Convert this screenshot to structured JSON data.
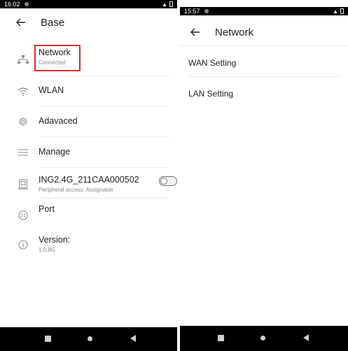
{
  "left": {
    "status": {
      "time": "16:02"
    },
    "header": {
      "title": "Base"
    },
    "items": [
      {
        "label": "Network",
        "sub": "Connected",
        "icon": "network-icon"
      },
      {
        "label": "WLAN",
        "icon": "wifi-icon"
      },
      {
        "label": "Adavaced",
        "icon": "gear-icon"
      },
      {
        "label": "Manage",
        "icon": "menu-icon"
      },
      {
        "label": "ING2.4G_211CAA000502",
        "sub": "Peripheral access: Assignable",
        "icon": "device-icon"
      },
      {
        "label": "Port",
        "icon": "port-icon"
      },
      {
        "label": "Version:",
        "sub": "1.0.8G",
        "icon": "info-icon"
      }
    ]
  },
  "right": {
    "status": {
      "time": "15:57"
    },
    "header": {
      "title": "Network"
    },
    "items": [
      {
        "label": "WAN Setting"
      },
      {
        "label": "LAN Setting"
      }
    ]
  },
  "colors": {
    "highlight": "#d32f2f",
    "toggle_off": "#f2f2f2"
  }
}
